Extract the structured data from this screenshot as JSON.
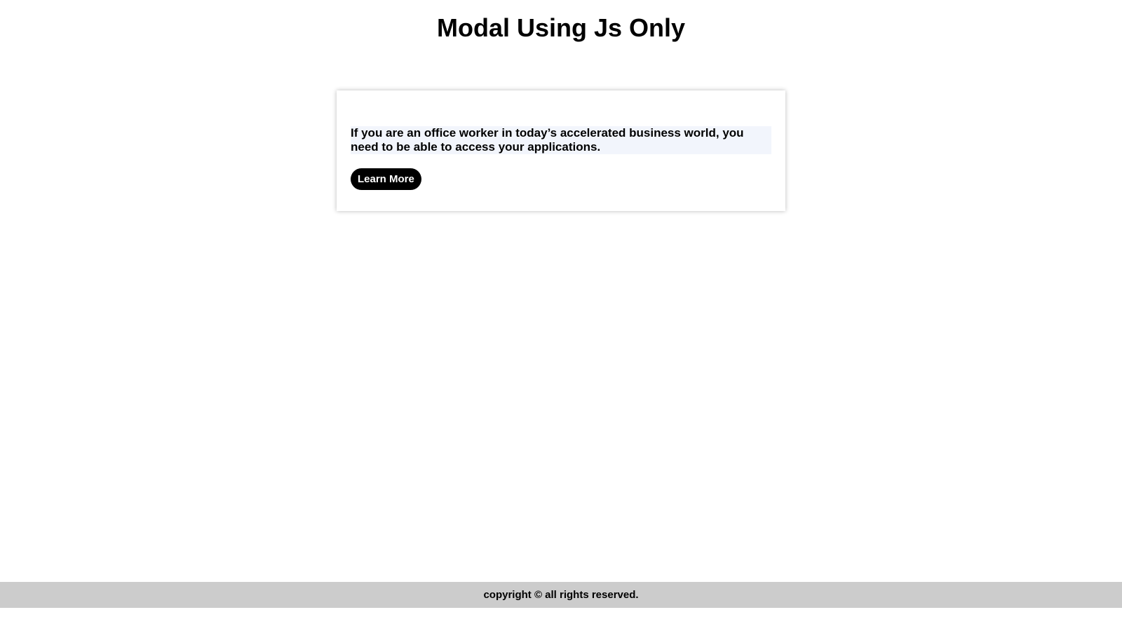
{
  "header": {
    "title": "Modal Using Js Only"
  },
  "card": {
    "text": "If you are an office worker in today’s accelerated business world, you need to be able to access your applications.",
    "button_label": "Learn More"
  },
  "footer": {
    "copyright": "copyright © all rights reserved."
  },
  "colors": {
    "background": "#ffffff",
    "button_background": "#000000",
    "button_text": "#ffffff",
    "text_highlight": "#f2f5fc",
    "footer_background": "#cccccc"
  }
}
